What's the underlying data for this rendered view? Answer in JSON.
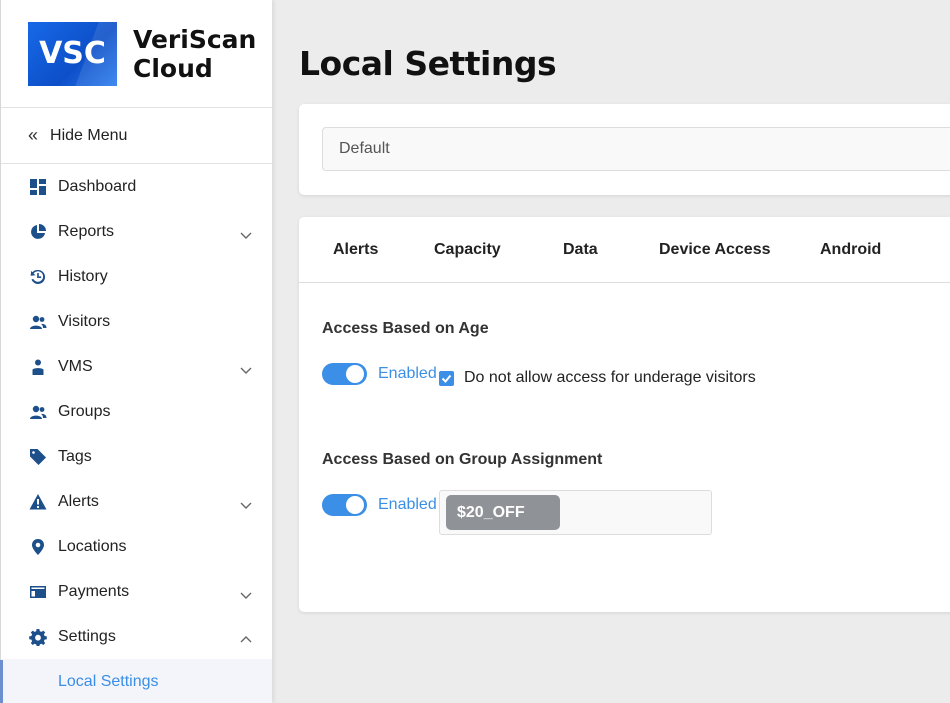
{
  "brand": {
    "logo_text": "VSC",
    "name_line1": "VeriScan",
    "name_line2": "Cloud"
  },
  "sidebar": {
    "hide_menu": "Hide Menu",
    "items": [
      {
        "label": "Dashboard",
        "icon": "dashboard-icon",
        "expandable": false
      },
      {
        "label": "Reports",
        "icon": "reports-icon",
        "expandable": true
      },
      {
        "label": "History",
        "icon": "history-icon",
        "expandable": false
      },
      {
        "label": "Visitors",
        "icon": "visitors-icon",
        "expandable": false
      },
      {
        "label": "VMS",
        "icon": "vms-icon",
        "expandable": true
      },
      {
        "label": "Groups",
        "icon": "groups-icon",
        "expandable": false
      },
      {
        "label": "Tags",
        "icon": "tag-icon",
        "expandable": false
      },
      {
        "label": "Alerts",
        "icon": "alert-icon",
        "expandable": true
      },
      {
        "label": "Locations",
        "icon": "location-pin-icon",
        "expandable": false
      },
      {
        "label": "Payments",
        "icon": "payments-icon",
        "expandable": true
      },
      {
        "label": "Settings",
        "icon": "gear-icon",
        "expandable": true,
        "expanded": true
      }
    ],
    "sub_items": [
      {
        "label": "Local Settings",
        "active": true
      }
    ]
  },
  "main": {
    "title": "Local Settings",
    "selector": {
      "value": "Default"
    },
    "tabs": [
      {
        "label": "Alerts"
      },
      {
        "label": "Capacity"
      },
      {
        "label": "Data"
      },
      {
        "label": "Device Access"
      },
      {
        "label": "Android"
      }
    ],
    "age_section": {
      "title": "Access Based on Age",
      "toggle_label": "Enabled",
      "toggle_on": true,
      "checkbox_label": "Do not allow access for underage visitors",
      "checkbox_checked": true
    },
    "group_section": {
      "title": "Access Based on Group Assignment",
      "toggle_label": "Enabled",
      "toggle_on": true,
      "tags": [
        "$20_OFF"
      ]
    }
  },
  "colors": {
    "accent": "#3b8fe6",
    "nav_icon": "#1d4f8a",
    "chip": "#8f9397",
    "logo": "#1769e8"
  }
}
